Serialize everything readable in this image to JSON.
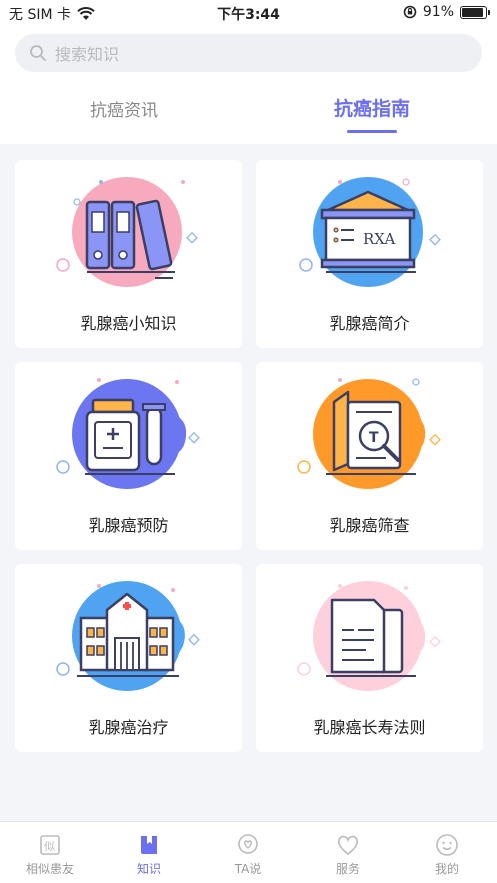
{
  "status_bar": {
    "carrier": "无 SIM 卡",
    "time": "下午3:44",
    "battery_pct": "91%"
  },
  "search": {
    "placeholder": "搜索知识"
  },
  "tabs": [
    {
      "label": "抗癌资讯",
      "active": false
    },
    {
      "label": "抗癌指南",
      "active": true
    }
  ],
  "cards": [
    {
      "label": "乳腺癌小知识",
      "icon": "binders-icon",
      "blob_color": "#f7a9bd"
    },
    {
      "label": "乳腺癌简介",
      "icon": "presentation-board-icon",
      "blob_color": "#4fa3f0"
    },
    {
      "label": "乳腺癌预防",
      "icon": "medicine-bottle-icon",
      "blob_color": "#6b76f0"
    },
    {
      "label": "乳腺癌筛查",
      "icon": "book-magnifier-icon",
      "blob_color": "#ff9a2a"
    },
    {
      "label": "乳腺癌治疗",
      "icon": "hospital-icon",
      "blob_color": "#4fa3f0"
    },
    {
      "label": "乳腺癌长寿法则",
      "icon": "document-icon",
      "blob_color": "#fdd0dc"
    }
  ],
  "board_text": "RXA",
  "tabbar": [
    {
      "label": "相似患友",
      "icon": "similar-patients-icon",
      "active": false
    },
    {
      "label": "知识",
      "icon": "knowledge-book-icon",
      "active": true
    },
    {
      "label": "TA说",
      "icon": "heart-chat-icon",
      "active": false
    },
    {
      "label": "服务",
      "icon": "heart-icon",
      "active": false
    },
    {
      "label": "我的",
      "icon": "smiley-icon",
      "active": false
    }
  ],
  "colors": {
    "accent": "#6b6ff0",
    "background": "#f4f5f9"
  }
}
